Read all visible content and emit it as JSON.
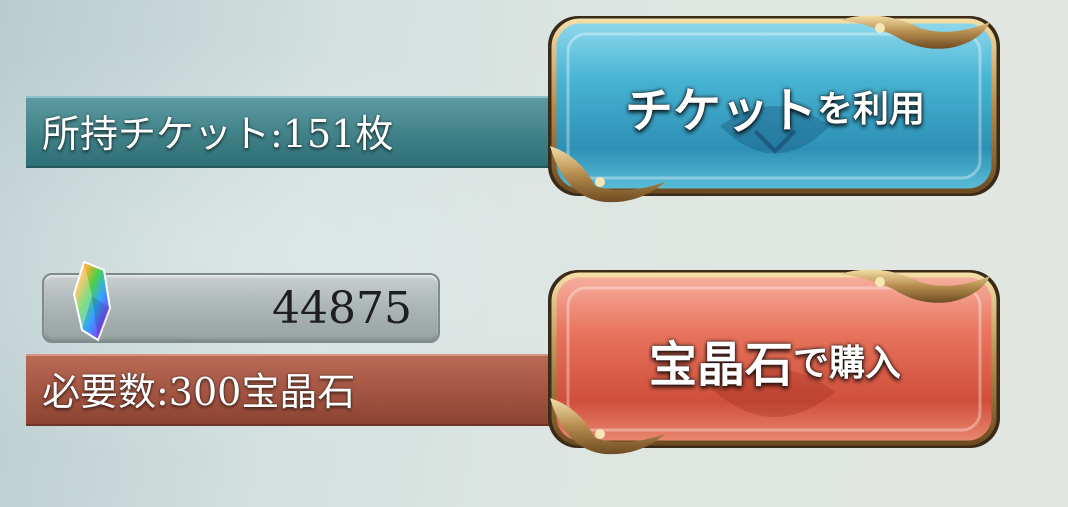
{
  "tickets": {
    "owned_label": "所持チケット:151枚",
    "use_button": {
      "main": "チケット",
      "suffix": "を利用"
    }
  },
  "gems": {
    "balance": "44875",
    "cost_label": "必要数:300宝晶石",
    "buy_button": {
      "main": "宝晶石",
      "suffix": "で購入"
    }
  },
  "icons": {
    "crystal": "rainbow-crystal-icon"
  },
  "colors": {
    "ticket_bar": "#3e7f86",
    "cost_bar": "#a0523f",
    "use_button": "#3fa6c8",
    "buy_button": "#e06a55",
    "frame_gold": "#c9a768"
  }
}
